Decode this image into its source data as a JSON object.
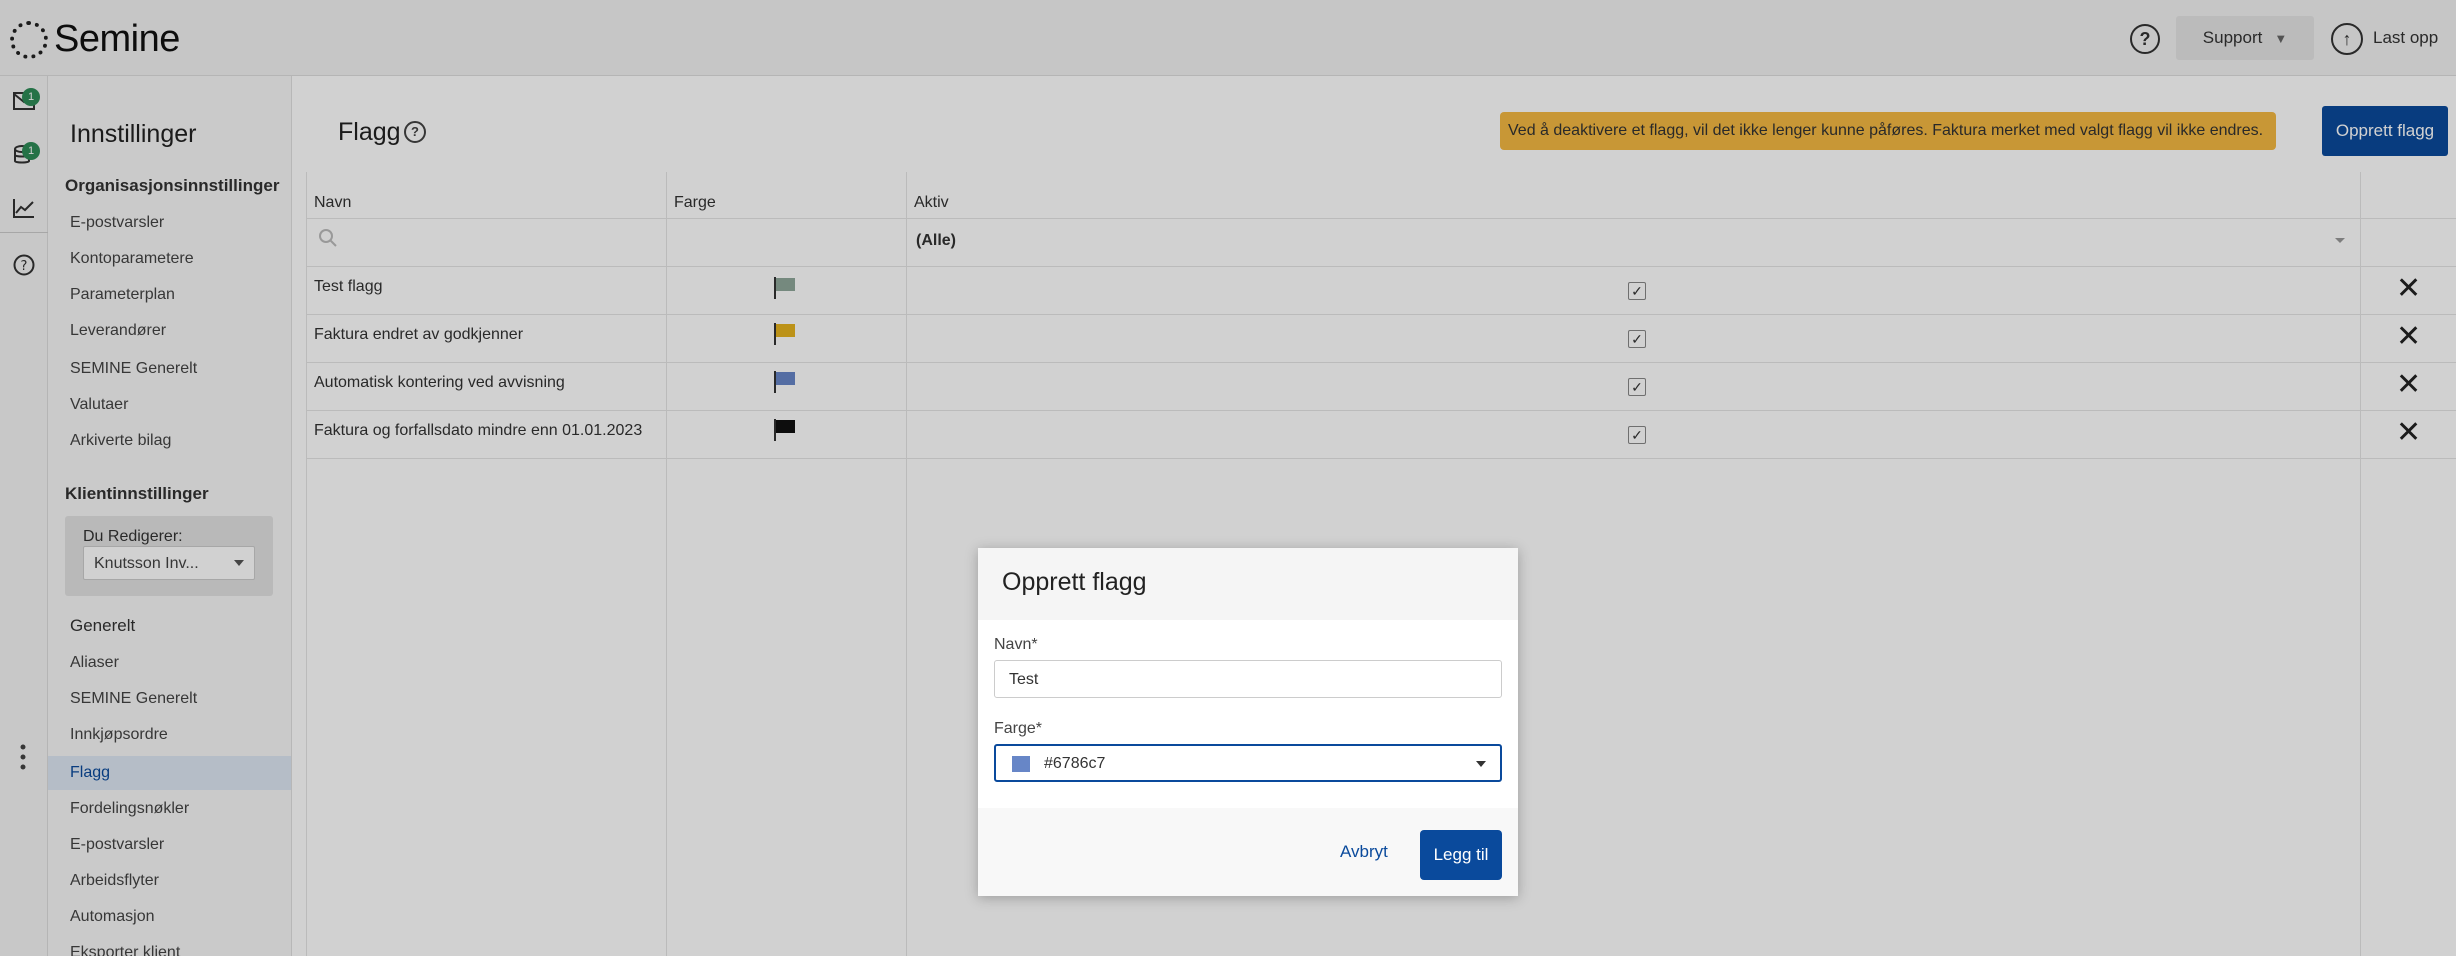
{
  "app": {
    "name": "Semine"
  },
  "topbar": {
    "help_icon": "?",
    "support_label": "Support",
    "support_caret": "▼",
    "upload_icon": "↑",
    "upload_label": "Last opp"
  },
  "rail": {
    "mail_badge": "1",
    "docs_badge": "1"
  },
  "settings": {
    "title": "Innstillinger",
    "org_section": "Organisasjonsinnstillinger",
    "org_items": [
      "E-postvarsler",
      "Kontoparametere",
      "Parameterplan",
      "Leverandører",
      "SEMINE Generelt",
      "Valutaer",
      "Arkiverte bilag"
    ],
    "client_section": "Klientinnstillinger",
    "editor_label": "Du Redigerer:",
    "editor_value": "Knutsson Inv...",
    "general_section": "Generelt",
    "general_items": [
      "Aliaser",
      "SEMINE Generelt",
      "Innkjøpsordre",
      "Flagg",
      "Fordelingsnøkler",
      "E-postvarsler",
      "Arbeidsflyter",
      "Automasjon",
      "Eksporter klient"
    ],
    "active_item": "Flagg"
  },
  "main": {
    "title": "Flagg",
    "help_icon": "?",
    "warning": "Ved å deaktivere et flagg, vil det ikke lenger kunne påføres. Faktura merket med valgt flagg vil ikke endres.",
    "create_button": "Opprett flagg"
  },
  "table": {
    "columns": [
      "Navn",
      "Farge",
      "Aktiv"
    ],
    "filter_active": "(Alle)",
    "rows": [
      {
        "name": "Test flagg",
        "color": "#8fa89a",
        "active": true
      },
      {
        "name": "Faktura endret av godkjenner",
        "color": "#e6b21e",
        "active": true
      },
      {
        "name": "Automatisk kontering ved avvisning",
        "color": "#6786c7",
        "active": true
      },
      {
        "name": "Faktura og forfallsdato mindre enn 01.01.2023",
        "color": "#111111",
        "active": true
      }
    ],
    "check_glyph": "✓",
    "delete_glyph": "✕"
  },
  "modal": {
    "title": "Opprett flagg",
    "name_label": "Navn*",
    "name_value": "Test",
    "color_label": "Farge*",
    "color_value": "#6786c7",
    "cancel_label": "Avbryt",
    "submit_label": "Legg til"
  }
}
